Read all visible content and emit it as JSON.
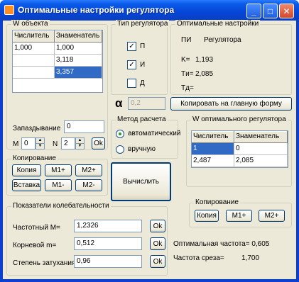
{
  "window": {
    "title": "Оптимальные настройки регулятора"
  },
  "titlebar": {
    "minimize": "_",
    "maximize": "□",
    "close": "✕"
  },
  "w_object": {
    "label": "W объекта",
    "headers": [
      "Числитель",
      "Знаменатель"
    ],
    "rows": [
      [
        "1,000",
        "1,000"
      ],
      [
        "",
        "3,118"
      ],
      [
        "",
        "3,357"
      ]
    ]
  },
  "delay": {
    "label": "Запаздывание",
    "value": "0",
    "m_label": "M",
    "m_value": "0",
    "n_label": "N",
    "n_value": "2",
    "ok": "Ok"
  },
  "copy_group": {
    "label": "Копирование",
    "copy": "Копия",
    "m1plus": "M1+",
    "m2plus": "M2+",
    "paste": "Вставка",
    "m1minus": "M1-",
    "m2minus": "M2-"
  },
  "regulator_type": {
    "label": "Тип регулятора",
    "p": "П",
    "p_checked": "✓",
    "i": "И",
    "i_checked": "✓",
    "d": "Д",
    "d_checked": ""
  },
  "optimal": {
    "label": "Оптимальные настройки",
    "pi": "ПИ",
    "regulator": "Регулятора",
    "k": "K=",
    "k_value": "1,193",
    "ti": "Tи=",
    "ti_value": "2,085",
    "td": "Tд=",
    "td_value": ""
  },
  "alpha": {
    "symbol": "α",
    "value": "0,2"
  },
  "copy_main_button": "Копировать на главную форму",
  "method": {
    "label": "Метод расчета",
    "auto": "автоматический",
    "manual": "вручную",
    "selected": "auto"
  },
  "calc_button": "Вычислить",
  "w_optimal": {
    "label": "W оптимального регулятора",
    "headers": [
      "Числитель",
      "Знаменатель"
    ],
    "rows": [
      [
        "1",
        "0"
      ],
      [
        "2,487",
        "2,085"
      ]
    ]
  },
  "oscillation": {
    "label": "Показатели колебательности",
    "freq_label": "Частотный  M=",
    "freq_value": "1,2326",
    "root_label": "Корневой     m=",
    "root_value": "0,512",
    "damp_label": "Степень затухания",
    "damp_value": "0,96",
    "ok": "Ok"
  },
  "copy_group2": {
    "label": "Копирование",
    "copy": "Копия",
    "m1plus": "M1+",
    "m2plus": "M2+"
  },
  "results": {
    "opt_freq": "Оптимальная частота= 0,605",
    "cut_freq_label": "Частота среза=",
    "cut_freq_value": "1,700"
  },
  "colors": {
    "titlebar": "#0a5ae8",
    "selection": "#316ac5",
    "face": "#ece9d8"
  }
}
